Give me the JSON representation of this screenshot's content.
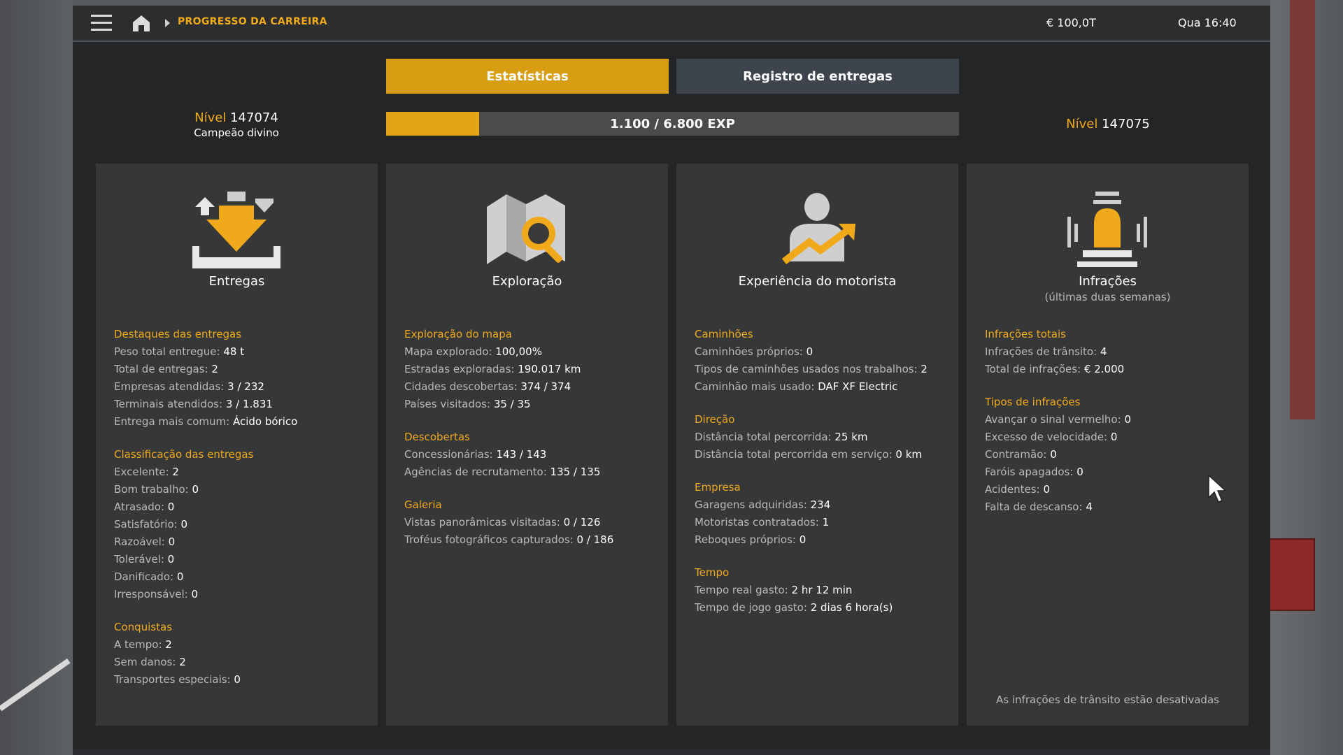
{
  "topbar": {
    "breadcrumb": "PROGRESSO DA CARREIRA",
    "money": "€ 100,0T",
    "clock": "Qua 16:40"
  },
  "tabs": [
    {
      "label": "Estatísticas",
      "active": true
    },
    {
      "label": "Registro de entregas",
      "active": false
    }
  ],
  "level": {
    "current_label": "Nível",
    "current_value": "147074",
    "rank": "Campeão divino",
    "next_label": "Nível",
    "next_value": "147075",
    "xp_text": "1.100 / 6.800 EXP",
    "xp_fraction": 0.162
  },
  "columns": [
    {
      "icon": "delivery-icon",
      "title": "Entregas",
      "subtitle": "",
      "sections": [
        {
          "title": "Destaques das entregas",
          "rows": [
            {
              "label": "Peso total entregue:",
              "value": "48 t"
            },
            {
              "label": "Total de entregas:",
              "value": "2"
            },
            {
              "label": "Empresas atendidas:",
              "value": "3 / 232"
            },
            {
              "label": "Terminais atendidos:",
              "value": "3 / 1.831"
            },
            {
              "label": "Entrega mais comum:",
              "value": "Ácido bórico"
            }
          ]
        },
        {
          "title": "Classificação das entregas",
          "rows": [
            {
              "label": "Excelente:",
              "value": "2"
            },
            {
              "label": "Bom trabalho:",
              "value": "0"
            },
            {
              "label": "Atrasado:",
              "value": "0"
            },
            {
              "label": "Satisfatório:",
              "value": "0"
            },
            {
              "label": "Razoável:",
              "value": "0"
            },
            {
              "label": "Tolerável:",
              "value": "0"
            },
            {
              "label": "Danificado:",
              "value": "0"
            },
            {
              "label": "Irresponsável:",
              "value": "0"
            }
          ]
        },
        {
          "title": "Conquistas",
          "rows": [
            {
              "label": "A tempo:",
              "value": "2"
            },
            {
              "label": "Sem danos:",
              "value": "2"
            },
            {
              "label": "Transportes especiais:",
              "value": "0"
            }
          ]
        }
      ]
    },
    {
      "icon": "map-search-icon",
      "title": "Exploração",
      "subtitle": "",
      "sections": [
        {
          "title": "Exploração do mapa",
          "rows": [
            {
              "label": "Mapa explorado:",
              "value": "100,00%"
            },
            {
              "label": "Estradas exploradas:",
              "value": "190.017 km"
            },
            {
              "label": "Cidades descobertas:",
              "value": "374 / 374"
            },
            {
              "label": "Países visitados:",
              "value": "35 / 35"
            }
          ]
        },
        {
          "title": "Descobertas",
          "rows": [
            {
              "label": "Concessionárias:",
              "value": "143 / 143"
            },
            {
              "label": "Agências de recrutamento:",
              "value": "135 / 135"
            }
          ]
        },
        {
          "title": "Galeria",
          "rows": [
            {
              "label": "Vistas panorâmicas visitadas:",
              "value": "0 / 126"
            },
            {
              "label": "Troféus fotográficos capturados:",
              "value": "0 / 186"
            }
          ]
        }
      ]
    },
    {
      "icon": "driver-growth-icon",
      "title": "Experiência do motorista",
      "subtitle": "",
      "sections": [
        {
          "title": "Caminhões",
          "rows": [
            {
              "label": "Caminhões próprios:",
              "value": "0"
            },
            {
              "label": "Tipos de caminhões usados nos trabalhos:",
              "value": "2"
            },
            {
              "label": "Caminhão mais usado:",
              "value": "DAF XF Electric"
            }
          ]
        },
        {
          "title": "Direção",
          "rows": [
            {
              "label": "Distância total percorrida:",
              "value": "25 km"
            },
            {
              "label": "Distância total percorrida em serviço:",
              "value": "0 km"
            }
          ]
        },
        {
          "title": "Empresa",
          "rows": [
            {
              "label": "Garagens adquiridas:",
              "value": "234"
            },
            {
              "label": "Motoristas contratados:",
              "value": "1"
            },
            {
              "label": "Reboques próprios:",
              "value": "0"
            }
          ]
        },
        {
          "title": "Tempo",
          "rows": [
            {
              "label": "Tempo real gasto:",
              "value": "2 hr 12 min"
            },
            {
              "label": "Tempo de jogo gasto:",
              "value": "2 dias 6 hora(s)"
            }
          ]
        }
      ]
    },
    {
      "icon": "siren-icon",
      "title": "Infrações",
      "subtitle": "(últimas duas semanas)",
      "footnote": "As infrações de trânsito estão desativadas",
      "sections": [
        {
          "title": "Infrações totais",
          "rows": [
            {
              "label": "Infrações de trânsito:",
              "value": "4"
            },
            {
              "label": "Total de infrações:",
              "value": "€ 2.000"
            }
          ]
        },
        {
          "title": "Tipos de infrações",
          "rows": [
            {
              "label": "Avançar o sinal vermelho:",
              "value": "0"
            },
            {
              "label": "Excesso de velocidade:",
              "value": "0"
            },
            {
              "label": "Contramão:",
              "value": "0"
            },
            {
              "label": "Faróis apagados:",
              "value": "0"
            },
            {
              "label": "Acidentes:",
              "value": "0"
            },
            {
              "label": "Falta de descanso:",
              "value": "4"
            }
          ]
        }
      ]
    }
  ]
}
